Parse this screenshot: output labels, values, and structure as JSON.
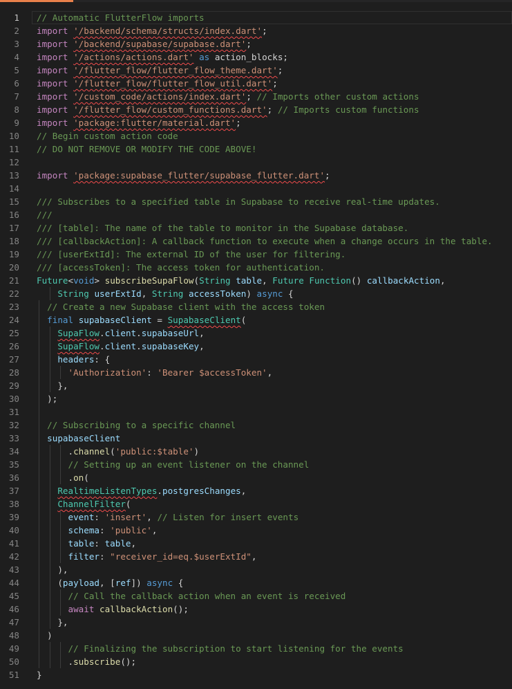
{
  "editor": {
    "lines": [
      {
        "n": "1",
        "cur": true,
        "tokens": [
          {
            "t": "// Automatic FlutterFlow imports",
            "c": "comment"
          }
        ]
      },
      {
        "n": "2",
        "tokens": [
          {
            "t": "import",
            "c": "control"
          },
          {
            "t": " "
          },
          {
            "t": "'/backend/schema/structs/index.dart'",
            "c": "string",
            "e": true
          },
          {
            "t": ";"
          }
        ]
      },
      {
        "n": "3",
        "tokens": [
          {
            "t": "import",
            "c": "control"
          },
          {
            "t": " "
          },
          {
            "t": "'/backend/supabase/supabase.dart'",
            "c": "string",
            "e": true
          },
          {
            "t": ";"
          }
        ]
      },
      {
        "n": "4",
        "tokens": [
          {
            "t": "import",
            "c": "control"
          },
          {
            "t": " "
          },
          {
            "t": "'/actions/actions.dart'",
            "c": "string",
            "e": true
          },
          {
            "t": " "
          },
          {
            "t": "as",
            "c": "keyword"
          },
          {
            "t": " action_blocks;"
          }
        ]
      },
      {
        "n": "5",
        "tokens": [
          {
            "t": "import",
            "c": "control"
          },
          {
            "t": " "
          },
          {
            "t": "'/flutter_flow/flutter_flow_theme.dart'",
            "c": "string",
            "e": true
          },
          {
            "t": ";"
          }
        ]
      },
      {
        "n": "6",
        "tokens": [
          {
            "t": "import",
            "c": "control"
          },
          {
            "t": " "
          },
          {
            "t": "'/flutter_flow/flutter_flow_util.dart'",
            "c": "string",
            "e": true
          },
          {
            "t": ";"
          }
        ]
      },
      {
        "n": "7",
        "tokens": [
          {
            "t": "import",
            "c": "control"
          },
          {
            "t": " "
          },
          {
            "t": "'/custom_code/actions/index.dart'",
            "c": "string",
            "e": true
          },
          {
            "t": "; "
          },
          {
            "t": "// Imports other custom actions",
            "c": "comment"
          }
        ]
      },
      {
        "n": "8",
        "tokens": [
          {
            "t": "import",
            "c": "control"
          },
          {
            "t": " "
          },
          {
            "t": "'/flutter_flow/custom_functions.dart'",
            "c": "string",
            "e": true
          },
          {
            "t": "; "
          },
          {
            "t": "// Imports custom functions",
            "c": "comment"
          }
        ]
      },
      {
        "n": "9",
        "tokens": [
          {
            "t": "import",
            "c": "control"
          },
          {
            "t": " "
          },
          {
            "t": "'package:flutter/material.dart'",
            "c": "string",
            "e": true
          },
          {
            "t": ";"
          }
        ]
      },
      {
        "n": "10",
        "tokens": [
          {
            "t": "// Begin custom action code",
            "c": "comment"
          }
        ]
      },
      {
        "n": "11",
        "tokens": [
          {
            "t": "// DO NOT REMOVE OR MODIFY THE CODE ABOVE!",
            "c": "comment"
          }
        ]
      },
      {
        "n": "12",
        "tokens": []
      },
      {
        "n": "13",
        "tokens": [
          {
            "t": "import",
            "c": "control"
          },
          {
            "t": " "
          },
          {
            "t": "'package:supabase_flutter/supabase_flutter.dart'",
            "c": "string",
            "e": true
          },
          {
            "t": ";"
          }
        ]
      },
      {
        "n": "14",
        "tokens": []
      },
      {
        "n": "15",
        "tokens": [
          {
            "t": "/// Subscribes to a specified table in Supabase to receive real-time updates.",
            "c": "comment"
          }
        ]
      },
      {
        "n": "16",
        "tokens": [
          {
            "t": "///",
            "c": "comment"
          }
        ]
      },
      {
        "n": "17",
        "tokens": [
          {
            "t": "/// [table]: The name of the table to monitor in the Supabase database.",
            "c": "comment"
          }
        ]
      },
      {
        "n": "18",
        "tokens": [
          {
            "t": "/// [callbackAction]: A callback function to execute when a change occurs in the table.",
            "c": "comment"
          }
        ]
      },
      {
        "n": "19",
        "tokens": [
          {
            "t": "/// [userExtId]: The external ID of the user for filtering.",
            "c": "comment"
          }
        ]
      },
      {
        "n": "20",
        "tokens": [
          {
            "t": "/// [accessToken]: The access token for authentication.",
            "c": "comment"
          }
        ]
      },
      {
        "n": "21",
        "tokens": [
          {
            "t": "Future",
            "c": "type"
          },
          {
            "t": "<"
          },
          {
            "t": "void",
            "c": "keyword"
          },
          {
            "t": "> "
          },
          {
            "t": "subscribeSupaFlow",
            "c": "func"
          },
          {
            "t": "("
          },
          {
            "t": "String",
            "c": "type"
          },
          {
            "t": " "
          },
          {
            "t": "table",
            "c": "param"
          },
          {
            "t": ", "
          },
          {
            "t": "Future",
            "c": "type"
          },
          {
            "t": " "
          },
          {
            "t": "Function",
            "c": "type"
          },
          {
            "t": "() "
          },
          {
            "t": "callbackAction",
            "c": "param"
          },
          {
            "t": ","
          }
        ]
      },
      {
        "n": "22",
        "g": [
          1
        ],
        "tokens": [
          {
            "t": "    "
          },
          {
            "t": "String",
            "c": "type"
          },
          {
            "t": " "
          },
          {
            "t": "userExtId",
            "c": "param"
          },
          {
            "t": ", "
          },
          {
            "t": "String",
            "c": "type"
          },
          {
            "t": " "
          },
          {
            "t": "accessToken",
            "c": "param"
          },
          {
            "t": ") "
          },
          {
            "t": "async",
            "c": "keyword"
          },
          {
            "t": " {"
          }
        ]
      },
      {
        "n": "23",
        "g": [
          0
        ],
        "tokens": [
          {
            "t": "  "
          },
          {
            "t": "// Create a new Supabase client with the access token",
            "c": "comment"
          }
        ]
      },
      {
        "n": "24",
        "g": [
          0
        ],
        "tokens": [
          {
            "t": "  "
          },
          {
            "t": "final",
            "c": "keyword"
          },
          {
            "t": " "
          },
          {
            "t": "supabaseClient",
            "c": "var"
          },
          {
            "t": " = "
          },
          {
            "t": "SupabaseClient",
            "c": "type",
            "e": true
          },
          {
            "t": "("
          }
        ]
      },
      {
        "n": "25",
        "g": [
          0,
          1
        ],
        "tokens": [
          {
            "t": "    "
          },
          {
            "t": "SupaFlow",
            "c": "type",
            "e": true
          },
          {
            "t": "."
          },
          {
            "t": "client",
            "c": "var"
          },
          {
            "t": "."
          },
          {
            "t": "supabaseUrl",
            "c": "var"
          },
          {
            "t": ","
          }
        ]
      },
      {
        "n": "26",
        "g": [
          0,
          1
        ],
        "tokens": [
          {
            "t": "    "
          },
          {
            "t": "SupaFlow",
            "c": "type",
            "e": true
          },
          {
            "t": "."
          },
          {
            "t": "client",
            "c": "var"
          },
          {
            "t": "."
          },
          {
            "t": "supabaseKey",
            "c": "var"
          },
          {
            "t": ","
          }
        ]
      },
      {
        "n": "27",
        "g": [
          0,
          1
        ],
        "tokens": [
          {
            "t": "    "
          },
          {
            "t": "headers",
            "c": "var"
          },
          {
            "t": ": {"
          }
        ]
      },
      {
        "n": "28",
        "g": [
          0,
          1,
          2
        ],
        "tokens": [
          {
            "t": "      "
          },
          {
            "t": "'Authorization'",
            "c": "string"
          },
          {
            "t": ": "
          },
          {
            "t": "'Bearer $accessToken'",
            "c": "string"
          },
          {
            "t": ","
          }
        ]
      },
      {
        "n": "29",
        "g": [
          0,
          1
        ],
        "tokens": [
          {
            "t": "    },"
          }
        ]
      },
      {
        "n": "30",
        "g": [
          0
        ],
        "tokens": [
          {
            "t": "  );"
          }
        ]
      },
      {
        "n": "31",
        "g": [
          0
        ],
        "tokens": []
      },
      {
        "n": "32",
        "g": [
          0
        ],
        "tokens": [
          {
            "t": "  "
          },
          {
            "t": "// Subscribing to a specific channel",
            "c": "comment"
          }
        ]
      },
      {
        "n": "33",
        "g": [
          0
        ],
        "tokens": [
          {
            "t": "  "
          },
          {
            "t": "supabaseClient",
            "c": "var"
          }
        ]
      },
      {
        "n": "34",
        "g": [
          0,
          1,
          2
        ],
        "tokens": [
          {
            "t": "      ."
          },
          {
            "t": "channel",
            "c": "func"
          },
          {
            "t": "("
          },
          {
            "t": "'public:$table'",
            "c": "string"
          },
          {
            "t": ")"
          }
        ]
      },
      {
        "n": "35",
        "g": [
          0,
          1,
          2
        ],
        "tokens": [
          {
            "t": "      "
          },
          {
            "t": "// Setting up an event listener on the channel",
            "c": "comment"
          }
        ]
      },
      {
        "n": "36",
        "g": [
          0,
          1,
          2
        ],
        "tokens": [
          {
            "t": "      ."
          },
          {
            "t": "on",
            "c": "func"
          },
          {
            "t": "("
          }
        ]
      },
      {
        "n": "37",
        "g": [
          0,
          1
        ],
        "tokens": [
          {
            "t": "    "
          },
          {
            "t": "RealtimeListenTypes",
            "c": "type",
            "e": true
          },
          {
            "t": "."
          },
          {
            "t": "postgresChanges",
            "c": "var"
          },
          {
            "t": ","
          }
        ]
      },
      {
        "n": "38",
        "g": [
          0,
          1
        ],
        "tokens": [
          {
            "t": "    "
          },
          {
            "t": "ChannelFilter",
            "c": "type",
            "e": true
          },
          {
            "t": "("
          }
        ]
      },
      {
        "n": "39",
        "g": [
          0,
          1,
          2
        ],
        "tokens": [
          {
            "t": "      "
          },
          {
            "t": "event",
            "c": "var"
          },
          {
            "t": ": "
          },
          {
            "t": "'insert'",
            "c": "string"
          },
          {
            "t": ", "
          },
          {
            "t": "// Listen for insert events",
            "c": "comment"
          }
        ]
      },
      {
        "n": "40",
        "g": [
          0,
          1,
          2
        ],
        "tokens": [
          {
            "t": "      "
          },
          {
            "t": "schema",
            "c": "var"
          },
          {
            "t": ": "
          },
          {
            "t": "'public'",
            "c": "string"
          },
          {
            "t": ","
          }
        ]
      },
      {
        "n": "41",
        "g": [
          0,
          1,
          2
        ],
        "tokens": [
          {
            "t": "      "
          },
          {
            "t": "table",
            "c": "var"
          },
          {
            "t": ": "
          },
          {
            "t": "table",
            "c": "var"
          },
          {
            "t": ","
          }
        ]
      },
      {
        "n": "42",
        "g": [
          0,
          1,
          2
        ],
        "tokens": [
          {
            "t": "      "
          },
          {
            "t": "filter",
            "c": "var"
          },
          {
            "t": ": "
          },
          {
            "t": "\"receiver_id=eq.$userExtId\"",
            "c": "string"
          },
          {
            "t": ","
          }
        ]
      },
      {
        "n": "43",
        "g": [
          0,
          1
        ],
        "tokens": [
          {
            "t": "    ),"
          }
        ]
      },
      {
        "n": "44",
        "g": [
          0,
          1
        ],
        "tokens": [
          {
            "t": "    ("
          },
          {
            "t": "payload",
            "c": "param"
          },
          {
            "t": ", ["
          },
          {
            "t": "ref",
            "c": "param"
          },
          {
            "t": "]) "
          },
          {
            "t": "async",
            "c": "keyword"
          },
          {
            "t": " {"
          }
        ]
      },
      {
        "n": "45",
        "g": [
          0,
          1,
          2
        ],
        "tokens": [
          {
            "t": "      "
          },
          {
            "t": "// Call the callback action when an event is received",
            "c": "comment"
          }
        ]
      },
      {
        "n": "46",
        "g": [
          0,
          1,
          2
        ],
        "tokens": [
          {
            "t": "      "
          },
          {
            "t": "await",
            "c": "control"
          },
          {
            "t": " "
          },
          {
            "t": "callbackAction",
            "c": "func"
          },
          {
            "t": "();"
          }
        ]
      },
      {
        "n": "47",
        "g": [
          0,
          1
        ],
        "tokens": [
          {
            "t": "    },"
          }
        ]
      },
      {
        "n": "48",
        "g": [
          0
        ],
        "tokens": [
          {
            "t": "  )"
          }
        ]
      },
      {
        "n": "49",
        "g": [
          0,
          1,
          2
        ],
        "tokens": [
          {
            "t": "      "
          },
          {
            "t": "// Finalizing the subscription to start listening for the events",
            "c": "comment"
          }
        ]
      },
      {
        "n": "50",
        "g": [
          0,
          1,
          2
        ],
        "tokens": [
          {
            "t": "      ."
          },
          {
            "t": "subscribe",
            "c": "func"
          },
          {
            "t": "();"
          }
        ]
      },
      {
        "n": "51",
        "tokens": [
          {
            "t": "}"
          }
        ]
      }
    ]
  }
}
